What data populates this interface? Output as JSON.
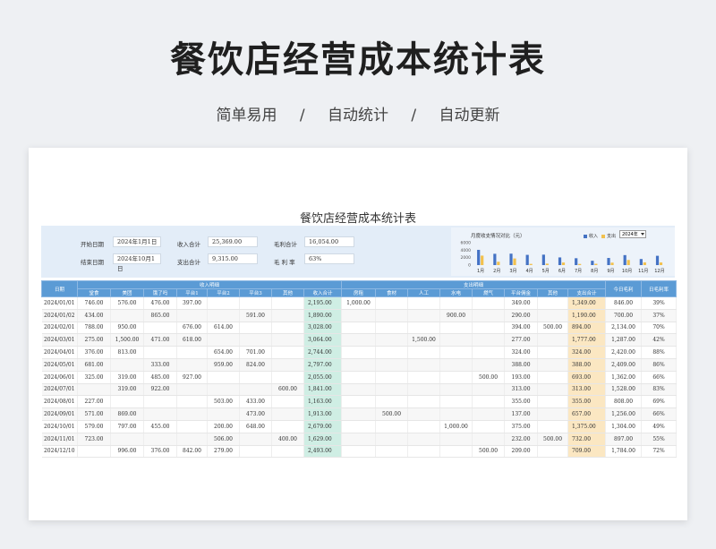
{
  "hero": {
    "title": "餐饮店经营成本统计表",
    "subtitle": [
      "简单易用",
      "/",
      "自动统计",
      "/",
      "自动更新"
    ]
  },
  "sheet": {
    "title": "餐饮店经营成本统计表",
    "summary": {
      "start_label": "开始日期",
      "start_value": "2024年1月1日",
      "end_label": "结束日期",
      "end_value": "2024年10月1日",
      "income_label": "收入合计",
      "income_value": "25,369.00",
      "expense_label": "支出合计",
      "expense_value": "9,315.00",
      "gross_label": "毛利合计",
      "gross_value": "16,054.00",
      "rate_label": "毛 利 率",
      "rate_value": "63%"
    },
    "chart": {
      "year": "2024年",
      "colors": {
        "income": "#4472c4",
        "expense": "#f2c14e"
      }
    },
    "table": {
      "group_headers": {
        "income": "收入明细",
        "expense": "支出明细"
      },
      "headers": [
        "日期",
        "堂食",
        "美团",
        "饿了吗",
        "平台1",
        "平台2",
        "平台3",
        "其他",
        "收入合计",
        "房租",
        "食材",
        "人工",
        "水电",
        "燃气",
        "平台佣金",
        "其他",
        "支出合计",
        "今日毛利",
        "日毛利率"
      ],
      "rows": [
        [
          "2024/01/01",
          "746.00",
          "576.00",
          "476.00",
          "397.00",
          "",
          "",
          "",
          "2,195.00",
          "1,000.00",
          "",
          "",
          "",
          "",
          "349.00",
          "",
          "1,349.00",
          "846.00",
          "39%"
        ],
        [
          "2024/01/02",
          "434.00",
          "",
          "865.00",
          "",
          "",
          "591.00",
          "",
          "1,890.00",
          "",
          "",
          "",
          "900.00",
          "",
          "290.00",
          "",
          "1,190.00",
          "700.00",
          "37%"
        ],
        [
          "2024/02/01",
          "788.00",
          "950.00",
          "",
          "676.00",
          "614.00",
          "",
          "",
          "3,028.00",
          "",
          "",
          "",
          "",
          "",
          "394.00",
          "500.00",
          "894.00",
          "2,134.00",
          "70%"
        ],
        [
          "2024/03/01",
          "275.00",
          "1,500.00",
          "471.00",
          "618.00",
          "",
          "",
          "",
          "3,064.00",
          "",
          "",
          "1,500.00",
          "",
          "",
          "277.00",
          "",
          "1,777.00",
          "1,287.00",
          "42%"
        ],
        [
          "2024/04/01",
          "376.00",
          "813.00",
          "",
          "",
          "654.00",
          "701.00",
          "",
          "2,744.00",
          "",
          "",
          "",
          "",
          "",
          "324.00",
          "",
          "324.00",
          "2,420.00",
          "88%"
        ],
        [
          "2024/05/01",
          "681.00",
          "",
          "333.00",
          "",
          "959.00",
          "824.00",
          "",
          "2,797.00",
          "",
          "",
          "",
          "",
          "",
          "388.00",
          "",
          "388.00",
          "2,409.00",
          "86%"
        ],
        [
          "2024/06/01",
          "325.00",
          "319.00",
          "485.00",
          "927.00",
          "",
          "",
          "",
          "2,055.00",
          "",
          "",
          "",
          "",
          "500.00",
          "193.00",
          "",
          "693.00",
          "1,362.00",
          "66%"
        ],
        [
          "2024/07/01",
          "",
          "319.00",
          "922.00",
          "",
          "",
          "",
          "600.00",
          "1,841.00",
          "",
          "",
          "",
          "",
          "",
          "313.00",
          "",
          "313.00",
          "1,528.00",
          "83%"
        ],
        [
          "2024/08/01",
          "227.00",
          "",
          "",
          "",
          "503.00",
          "433.00",
          "",
          "1,163.00",
          "",
          "",
          "",
          "",
          "",
          "355.00",
          "",
          "355.00",
          "808.00",
          "69%"
        ],
        [
          "2024/09/01",
          "571.00",
          "869.00",
          "",
          "",
          "",
          "473.00",
          "",
          "1,913.00",
          "",
          "500.00",
          "",
          "",
          "",
          "137.00",
          "",
          "657.00",
          "1,256.00",
          "66%"
        ],
        [
          "2024/10/01",
          "579.00",
          "797.00",
          "455.00",
          "",
          "200.00",
          "648.00",
          "",
          "2,679.00",
          "",
          "",
          "",
          "1,000.00",
          "",
          "375.00",
          "",
          "1,375.00",
          "1,304.00",
          "49%"
        ],
        [
          "2024/11/01",
          "723.00",
          "",
          "",
          "",
          "506.00",
          "",
          "400.00",
          "1,629.00",
          "",
          "",
          "",
          "",
          "",
          "232.00",
          "500.00",
          "732.00",
          "897.00",
          "55%"
        ],
        [
          "2024/12/10",
          "",
          "996.00",
          "376.00",
          "842.00",
          "279.00",
          "",
          "",
          "2,493.00",
          "",
          "",
          "",
          "",
          "500.00",
          "209.00",
          "",
          "709.00",
          "1,784.00",
          "72%"
        ]
      ]
    }
  },
  "chart_data": {
    "type": "bar",
    "title": "月度收支情况对比（元）",
    "categories": [
      "1月",
      "2月",
      "3月",
      "4月",
      "5月",
      "6月",
      "7月",
      "8月",
      "9月",
      "10月",
      "11月",
      "12月"
    ],
    "series": [
      {
        "name": "收入",
        "values": [
          4085,
          3028,
          3064,
          2744,
          2797,
          2055,
          1841,
          1163,
          1913,
          2679,
          1629,
          2493
        ]
      },
      {
        "name": "支出",
        "values": [
          2539,
          894,
          1777,
          324,
          388,
          693,
          313,
          355,
          657,
          1375,
          732,
          709
        ]
      }
    ],
    "yticks": [
      "6000",
      "4000",
      "2000",
      "0"
    ],
    "ylim": [
      0,
      6000
    ],
    "legend": "top-right"
  }
}
